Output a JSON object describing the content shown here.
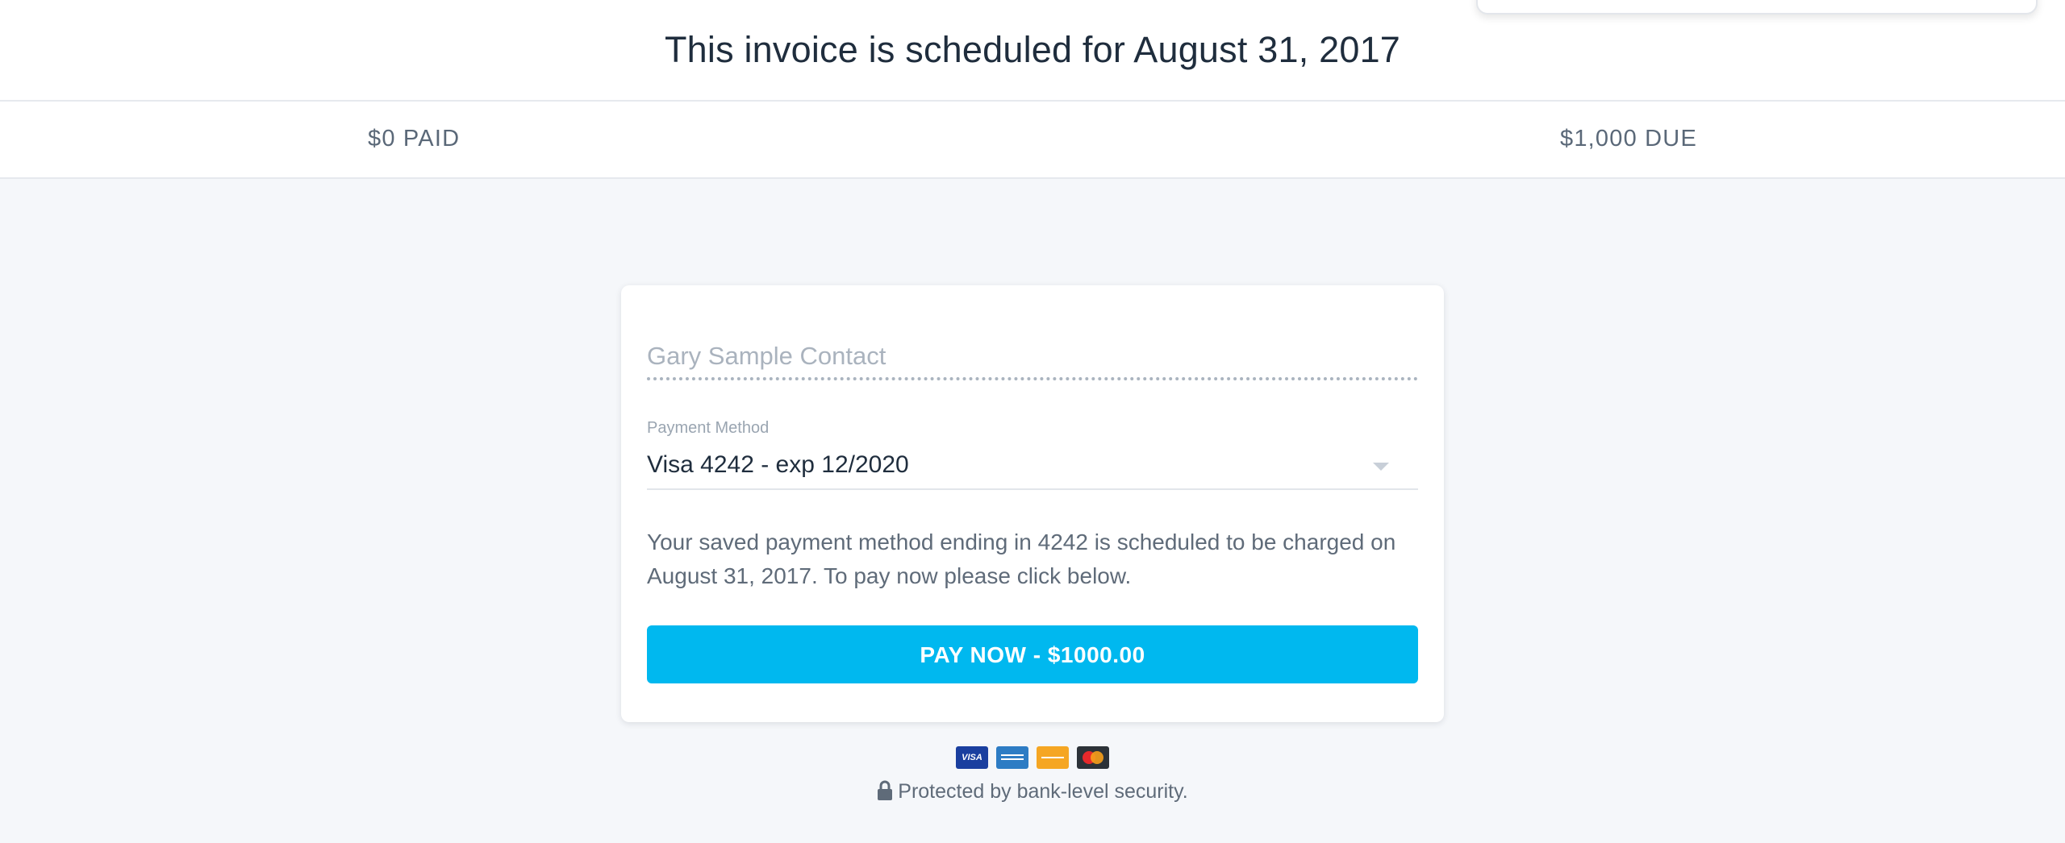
{
  "header": {
    "title": "This invoice is scheduled for August 31, 2017"
  },
  "status": {
    "paid": "$0 PAID",
    "due": "$1,000 DUE"
  },
  "form": {
    "contact_placeholder": "Gary Sample Contact",
    "contact_value": "",
    "payment_method_label": "Payment Method",
    "payment_method_value": "Visa 4242 - exp 12/2020",
    "notice": "Your saved payment method ending in 4242 is scheduled to be charged on August 31, 2017. To pay now please click below.",
    "pay_button_label": "PAY NOW - $1000.00"
  },
  "card_logos": [
    {
      "name": "visa",
      "text": "VISA"
    },
    {
      "name": "amex",
      "text": ""
    },
    {
      "name": "discover",
      "text": ""
    },
    {
      "name": "mastercard",
      "text": ""
    }
  ],
  "footer": {
    "security_text": "Protected by bank-level security.",
    "icon": "lock-icon"
  },
  "colors": {
    "accent": "#00b8ef",
    "background": "#f5f7fa",
    "text_primary": "#1f2d3d",
    "text_secondary": "#5f6b79"
  }
}
